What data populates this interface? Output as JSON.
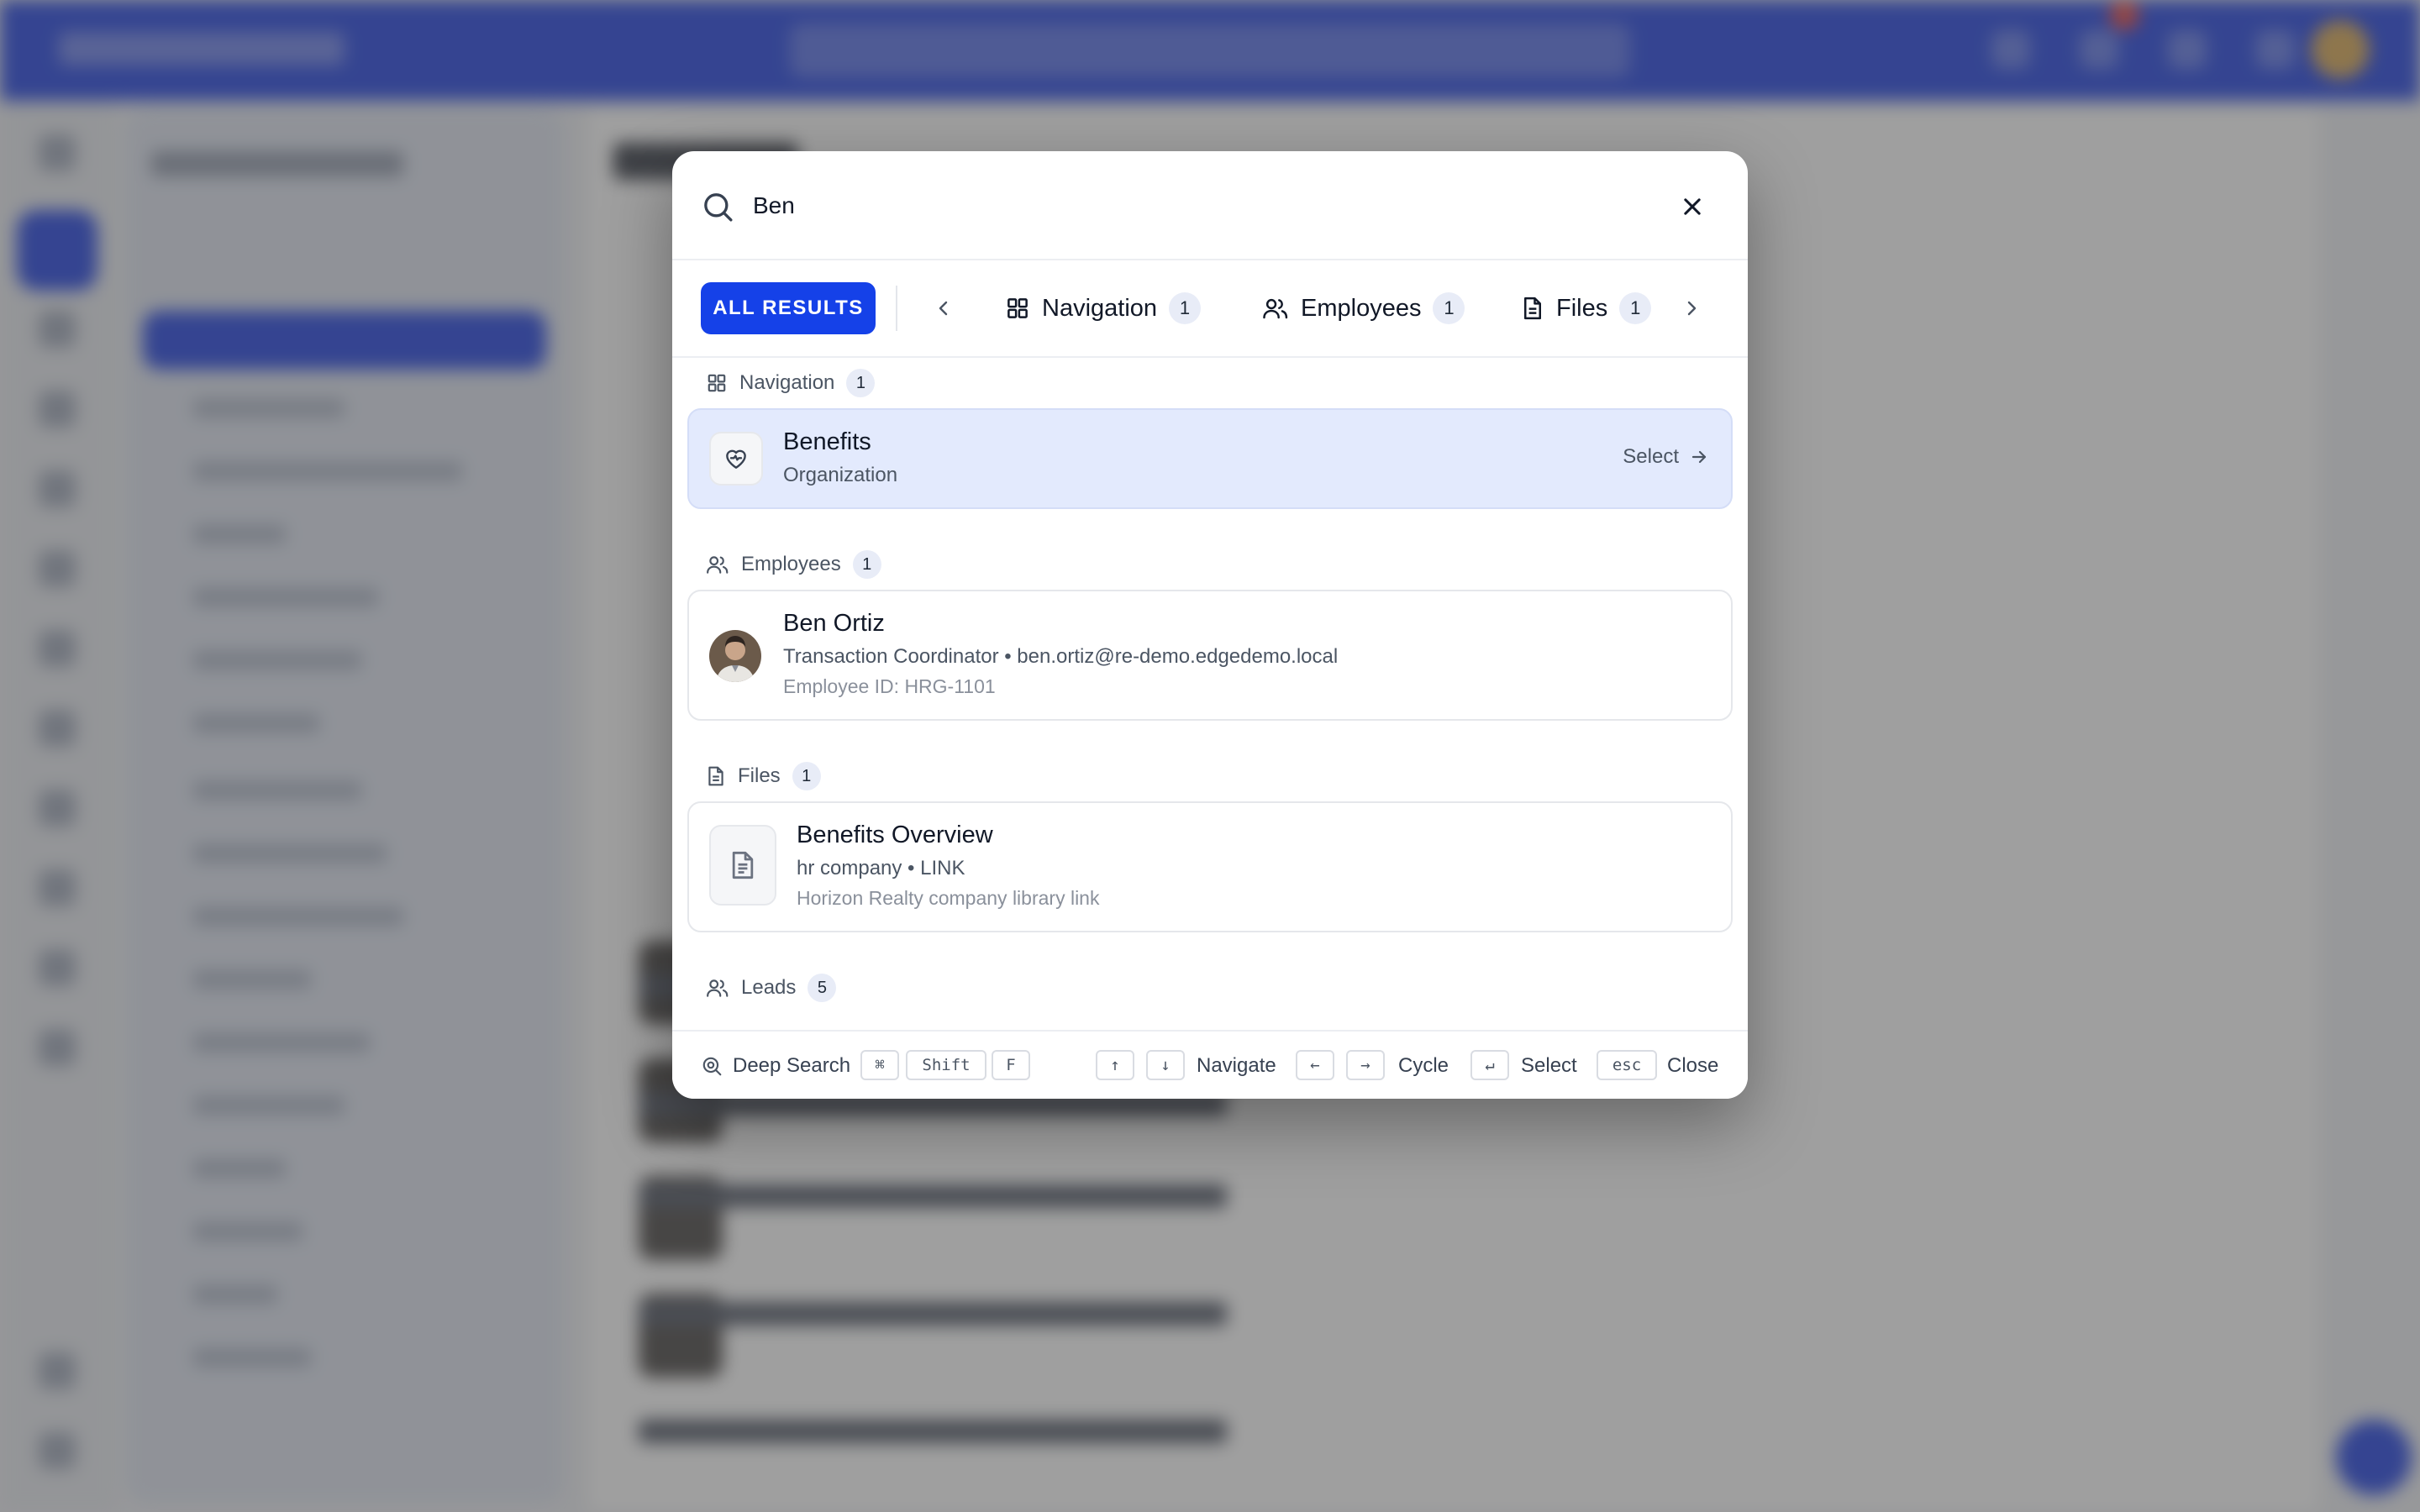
{
  "search": {
    "query": "Ben",
    "icon": "search-icon",
    "close_icon": "close-icon"
  },
  "tabs": {
    "all_label": "ALL RESULTS",
    "items": [
      {
        "label": "Navigation",
        "count": "1",
        "icon": "grid-icon"
      },
      {
        "label": "Employees",
        "count": "1",
        "icon": "users-icon"
      },
      {
        "label": "Files",
        "count": "1",
        "icon": "file-icon"
      }
    ]
  },
  "groups": {
    "navigation": {
      "label": "Navigation",
      "count": "1",
      "result": {
        "title": "Benefits",
        "subtitle": "Organization",
        "action": "Select",
        "icon": "heart-handshake-icon"
      }
    },
    "employees": {
      "label": "Employees",
      "count": "1",
      "result": {
        "name": "Ben Ortiz",
        "details": "Transaction Coordinator • ben.ortiz@re-demo.edgedemo.local",
        "employee_id": "Employee ID: HRG-1101"
      }
    },
    "files": {
      "label": "Files",
      "count": "1",
      "result": {
        "title": "Benefits Overview",
        "meta": "hr company • LINK",
        "description": "Horizon Realty company library link",
        "icon": "document-icon"
      }
    },
    "leads": {
      "label": "Leads",
      "count": "5"
    }
  },
  "footer": {
    "deep_search": "Deep Search",
    "keys": {
      "cmd": "⌘",
      "shift": "Shift",
      "f": "F",
      "up": "↑",
      "down": "↓",
      "left": "←",
      "right": "→",
      "enter": "↵",
      "esc": "esc"
    },
    "navigate": "Navigate",
    "cycle": "Cycle",
    "select": "Select",
    "close": "Close"
  },
  "colors": {
    "accent": "#1541e8",
    "topbar": "#1437e0",
    "active_result": "#e3eafd"
  }
}
